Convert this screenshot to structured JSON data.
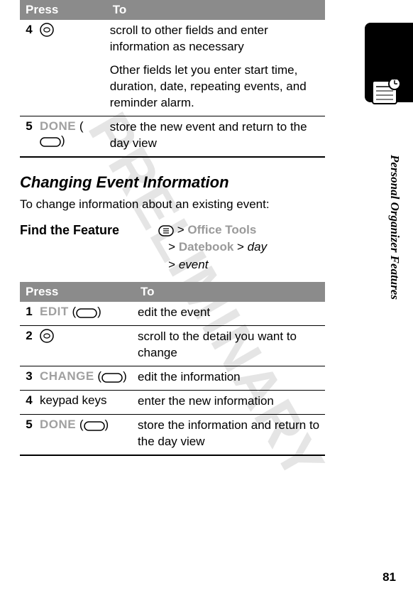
{
  "page_number": "81",
  "side_label": "Personal Organizer Features",
  "watermark": "PRELIMINARY",
  "table1": {
    "header_press": "Press",
    "header_to": "To",
    "rows": [
      {
        "num": "4",
        "press_text": "",
        "to_a": "scroll to other fields and enter information as necessary",
        "to_b": "Other fields let you enter start time, duration, date, repeating events, and reminder alarm."
      },
      {
        "num": "5",
        "press_label": "DONE",
        "to": "store the new event and return to the day view"
      }
    ]
  },
  "section_title": "Changing Event Information",
  "section_intro": "To change information about an existing event:",
  "find_feature": {
    "label": "Find the Feature",
    "path1a": "Office Tools",
    "path2a": "Datebook",
    "path2b": "day",
    "path3a": "event"
  },
  "table2": {
    "header_press": "Press",
    "header_to": "To",
    "rows": [
      {
        "num": "1",
        "press_label": "EDIT",
        "to": "edit the event"
      },
      {
        "num": "2",
        "press_label": "",
        "to": "scroll to the detail you want to change"
      },
      {
        "num": "3",
        "press_label": "CHANGE",
        "to": "edit the information"
      },
      {
        "num": "4",
        "press_plain": "keypad keys",
        "to": "enter the new information"
      },
      {
        "num": "5",
        "press_label": "DONE",
        "to": "store the information and return to the day view"
      }
    ]
  }
}
